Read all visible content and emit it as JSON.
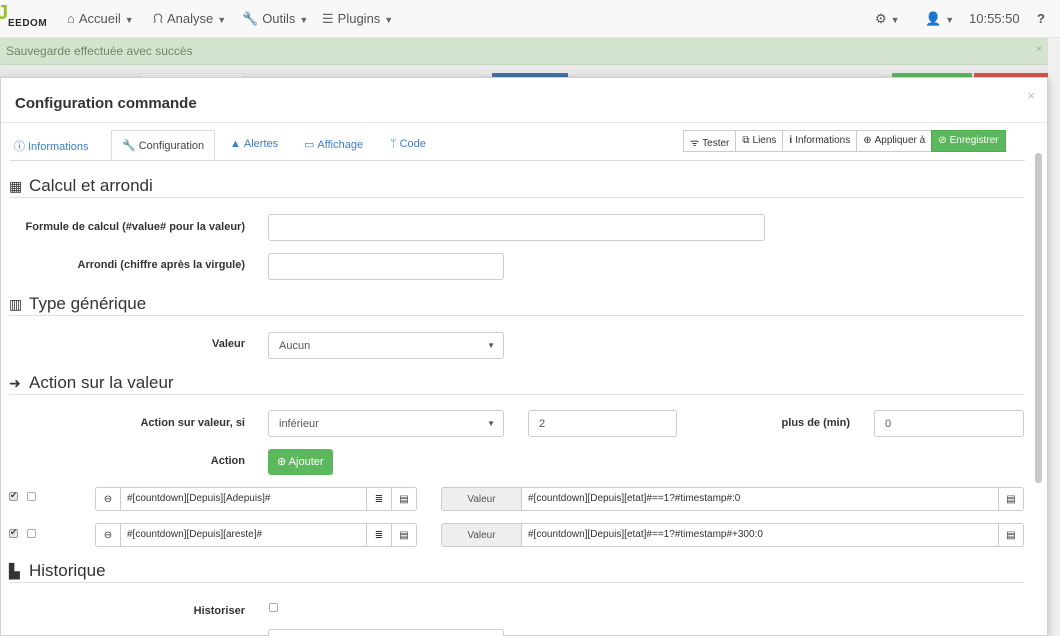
{
  "nav": {
    "logo_mark": "J",
    "logo_text": "EEDOM",
    "items": [
      {
        "label": "Accueil",
        "icon": "home-icon"
      },
      {
        "label": "Analyse",
        "icon": "stethoscope-icon"
      },
      {
        "label": "Outils",
        "icon": "wrench-icon"
      },
      {
        "label": "Plugins",
        "icon": "list-icon"
      }
    ],
    "time": "10:55:50",
    "help": "?"
  },
  "alert": {
    "message": "Sauvegarde effectuée avec succès",
    "close": "×"
  },
  "modal": {
    "title": "Configuration commande",
    "close": "×",
    "tabs": [
      {
        "label": "Informations",
        "icon": "info-circle-icon"
      },
      {
        "label": "Configuration",
        "icon": "wrench-icon"
      },
      {
        "label": "Alertes",
        "icon": "warning-icon"
      },
      {
        "label": "Affichage",
        "icon": "desktop-icon"
      },
      {
        "label": "Code",
        "icon": "code-branch-icon"
      }
    ],
    "buttons": {
      "tester": "Tester",
      "liens": "Liens",
      "informations": "Informations",
      "appliquer": "Appliquer à",
      "enregistrer": "Enregistrer"
    }
  },
  "calcul": {
    "title": "Calcul et arrondi",
    "formule_label": "Formule de calcul (#value# pour la valeur)",
    "formule_value": "",
    "arrondi_label": "Arrondi (chiffre après la virgule)",
    "arrondi_value": ""
  },
  "type_generique": {
    "title": "Type générique",
    "valeur_label": "Valeur",
    "valeur_selected": "Aucun"
  },
  "action": {
    "title": "Action sur la valeur",
    "si_label": "Action sur valeur, si",
    "operator": "inférieur",
    "threshold": "2",
    "plus_de_label": "plus de (min)",
    "plus_de_value": "0",
    "action_label": "Action",
    "add_button": "Ajouter",
    "rows": [
      {
        "cmd": "#[countdown][Depuis][Adepuis]#",
        "valeur_label": "Valeur",
        "valeur": "#[countdown][Depuis][etat]#==1?#timestamp#:0"
      },
      {
        "cmd": "#[countdown][Depuis][areste]#",
        "valeur_label": "Valeur",
        "valeur": "#[countdown][Depuis][etat]#==1?#timestamp#+300:0"
      }
    ]
  },
  "historique": {
    "title": "Historique",
    "historiser_label": "Historiser"
  }
}
